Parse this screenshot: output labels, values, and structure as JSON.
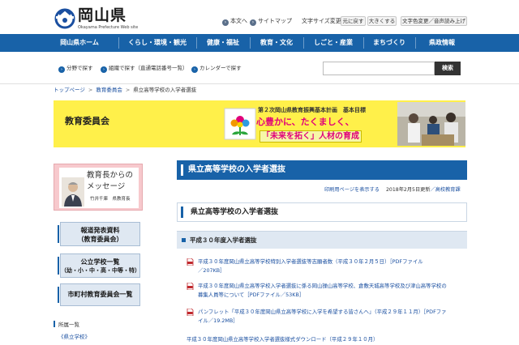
{
  "header": {
    "logo_text": "岡山県",
    "logo_subtext": "Okayama Prefecture Web site",
    "skip_link": "本文へ",
    "sitemap_link": "サイトマップ",
    "font_size_label": "文字サイズ変更",
    "font_reset": "元に戻す",
    "font_larger": "大きくする",
    "color_voice": "文字色変更／音声読み上げ"
  },
  "nav": {
    "items": [
      "岡山県ホーム",
      "くらし・環境・観光",
      "健康・福祉",
      "教育・文化",
      "しごと・産業",
      "まちづくり",
      "県政情報"
    ]
  },
  "subbar": {
    "links": [
      "分野で探す",
      "組織で探す（直通電話番号一覧）",
      "カレンダーで探す"
    ],
    "search_value": "",
    "search_button": "検索"
  },
  "breadcrumb": {
    "items": [
      "トップページ",
      "教育委員会",
      "県立高等学校の入学者選抜"
    ]
  },
  "banner": {
    "title": "教育委員会",
    "plan_line": "第２次岡山県教育振興基本計画　基本目標",
    "slogan1": "心豊かに、たくましく、",
    "slogan2": "「未来を拓く」人材の育成"
  },
  "sidebar": {
    "message_title1": "教育長からの",
    "message_title2": "メッセージ",
    "message_name": "竹井千庫　県教育長",
    "buttons": [
      {
        "line1": "報道発表資料",
        "line2": "（教育委員会）"
      },
      {
        "line1": "公立学校一覧",
        "line2": "（幼・小・中・高・中等・特）"
      },
      {
        "line1": "市町村教育委員会一覧",
        "line2": ""
      }
    ],
    "category_heading": "所属一覧",
    "category_link": "《県立学校》"
  },
  "main": {
    "title": "県立高等学校の入学者選抜",
    "print_link": "印刷用ページを表示する",
    "updated": "2018年2月5日更新",
    "section_link": "／高校教育課",
    "heading2": "県立高等学校の入学者選抜",
    "heading3": "平成３０年度入学者選抜",
    "items": [
      {
        "line1": "平成３０年度岡山県立高等学校特別入学者選抜等志願者数（平成３０年２月５日）［PDFファイル",
        "line2": "／207KB］"
      },
      {
        "line1": "平成３０年度岡山県立高等学校入学者選抜に係る岡山操山高等学校、倉敷天城高等学校及び津山高等学校の",
        "line2": "募集人員等について［PDFファイル／53KB］"
      },
      {
        "line1": "パンフレット「平成３０年度岡山県立高等学校に入学を希望する皆さんへ」（平成２９年１１月）［PDFファ",
        "line2": "イル／19.2MB］"
      }
    ],
    "plain_item": "平成３０年度岡山県立高等学校入学者選抜様式ダウンロード（平成２９年１０月）"
  },
  "colors": {
    "nav_blue": "#1862a8",
    "banner_yellow": "#fff04a",
    "slogan_pink": "#e0007a",
    "message_pink": "#f7c9cd",
    "light_blue": "#dfe8f2"
  }
}
